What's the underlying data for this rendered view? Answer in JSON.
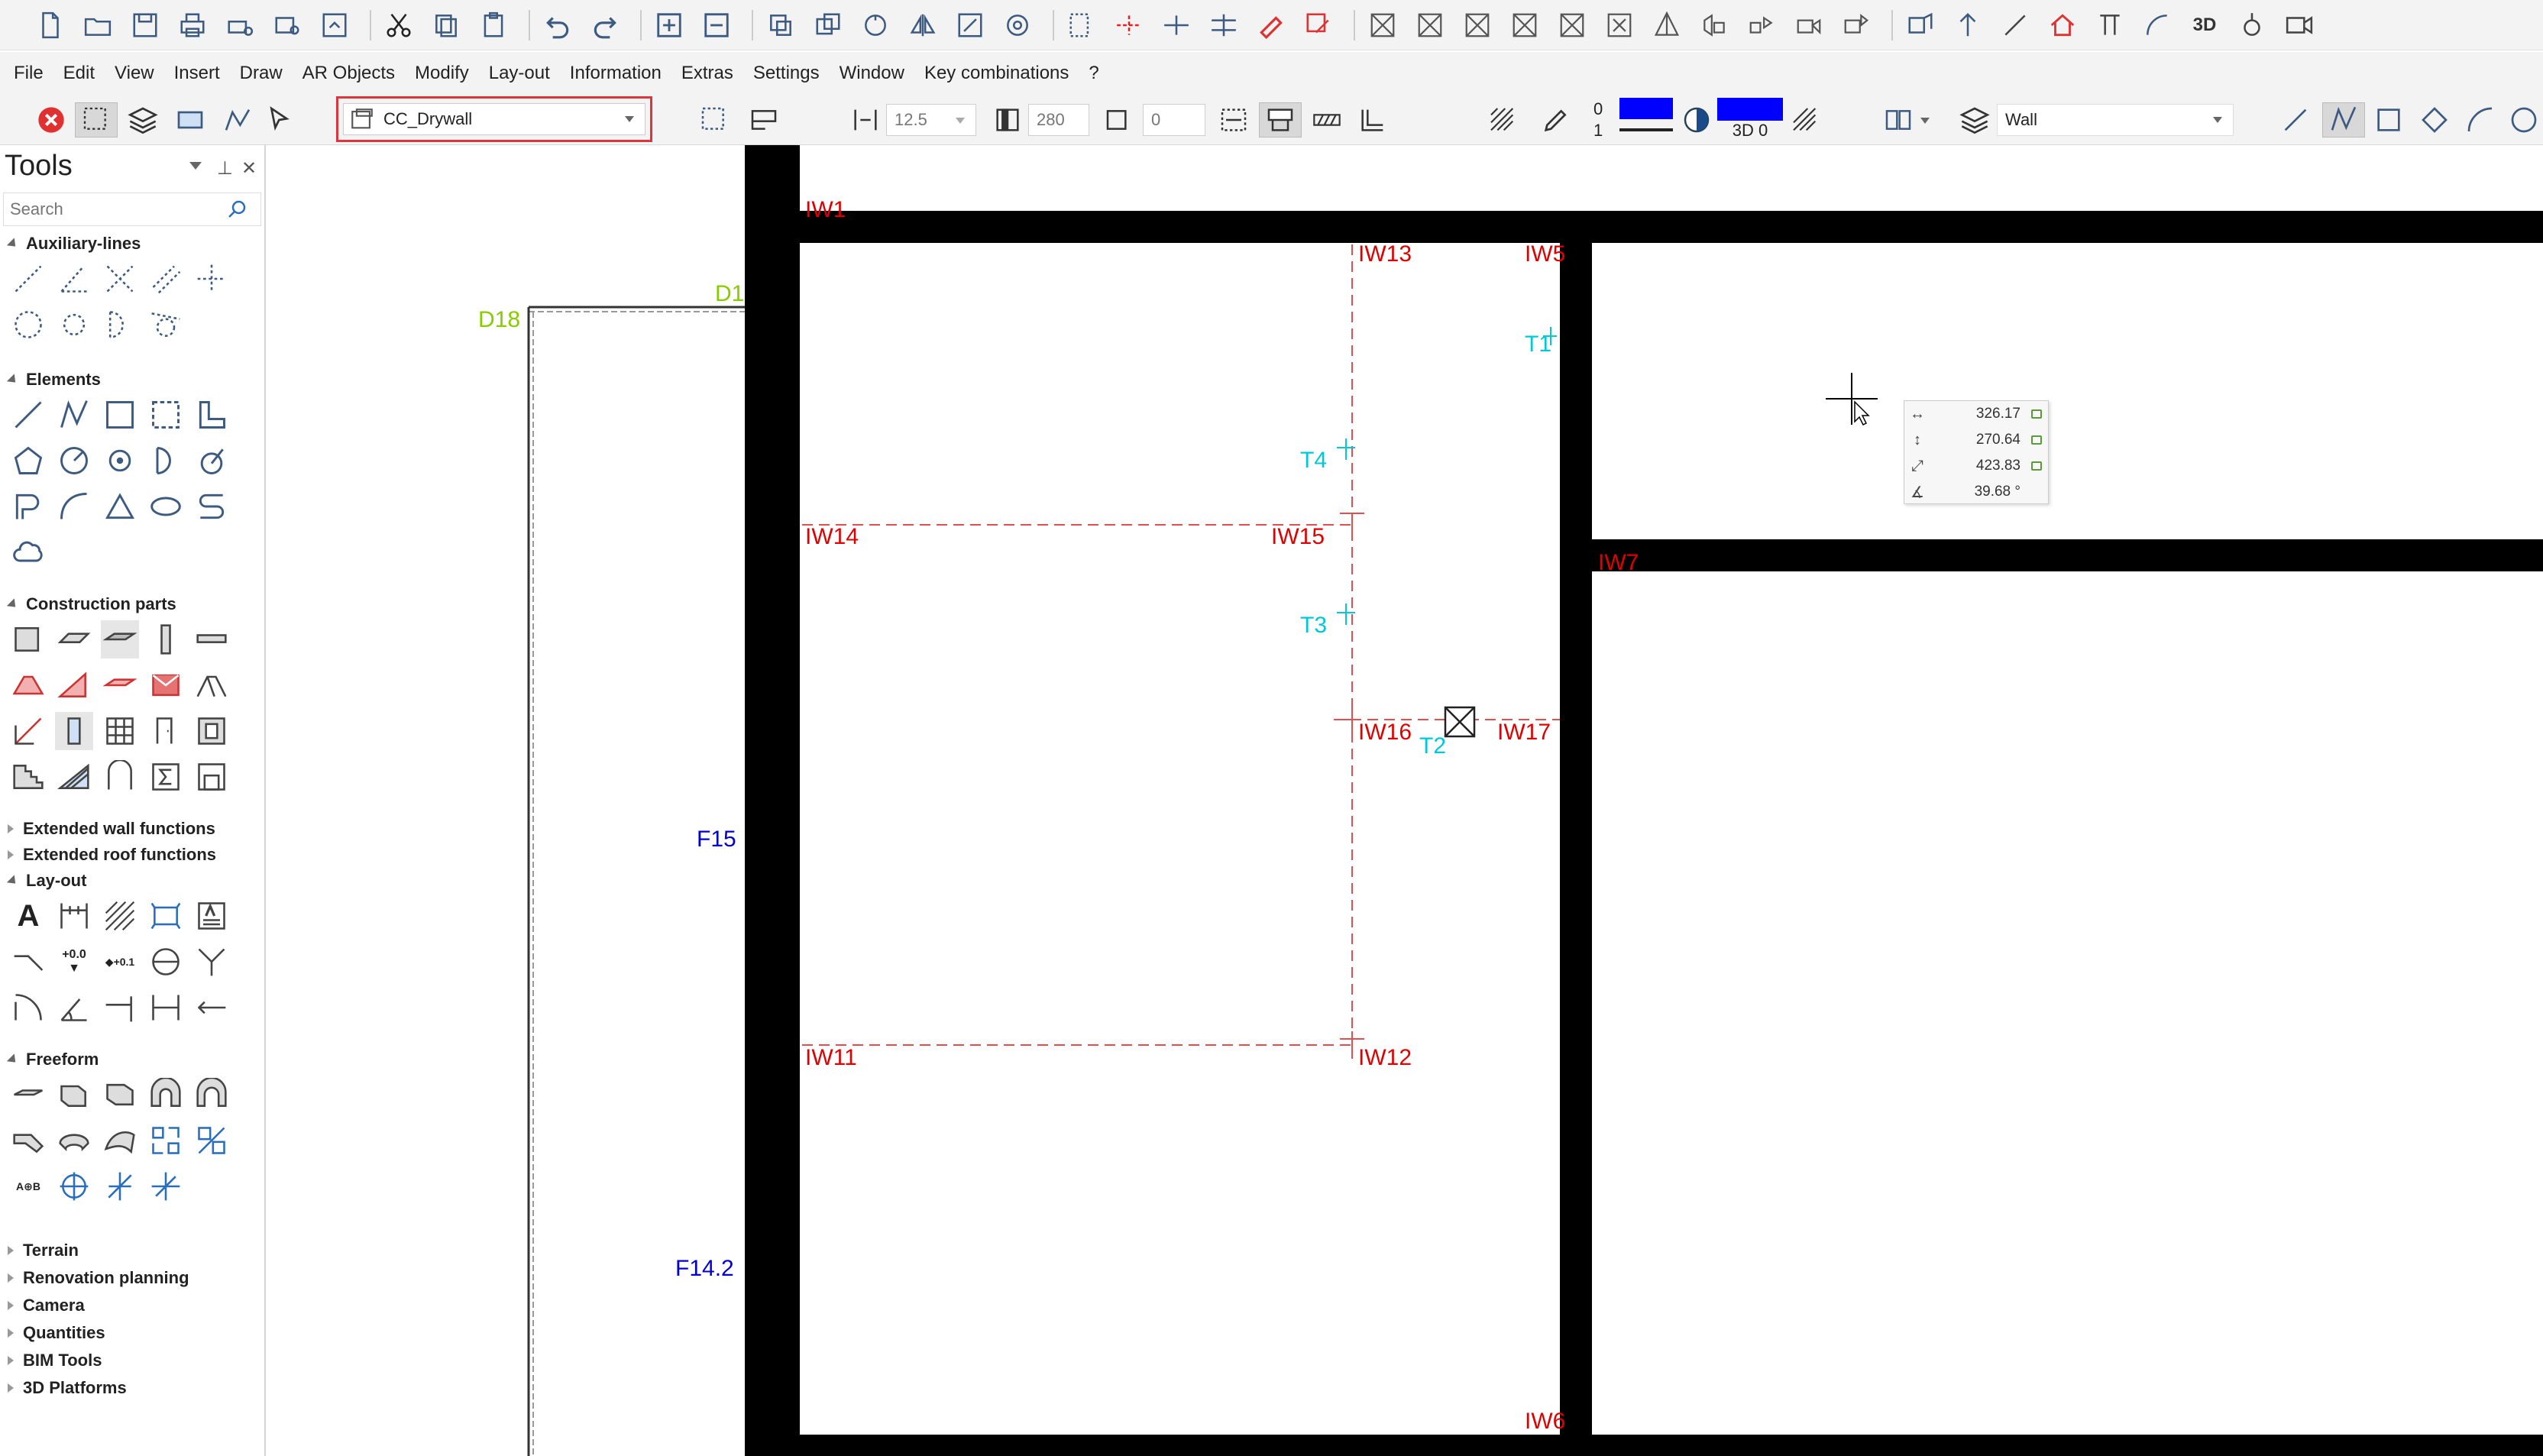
{
  "menu": [
    "File",
    "Edit",
    "View",
    "Insert",
    "Draw",
    "AR Objects",
    "Modify",
    "Lay-out",
    "Information",
    "Extras",
    "Settings",
    "Window",
    "Key combinations",
    "?"
  ],
  "props": {
    "style_select": "CC_Drywall",
    "thickness": "12.5",
    "height": "280",
    "offset": "0",
    "pen_top": "0",
    "pen_bottom": "1",
    "color_label": "3D 0",
    "layer_select": "Wall",
    "colors": {
      "pen": "#0000ff",
      "fill": "#0000ff"
    }
  },
  "tools": {
    "title": "Tools",
    "search_placeholder": "Search",
    "categories": {
      "auxiliary": "Auxiliary-lines",
      "elements": "Elements",
      "construction": "Construction parts",
      "ext_wall": "Extended wall functions",
      "ext_roof": "Extended roof functions",
      "layout": "Lay-out",
      "freeform": "Freeform",
      "terrain": "Terrain",
      "renovation": "Renovation planning",
      "camera": "Camera",
      "quantities": "Quantities",
      "bim": "BIM Tools",
      "platforms": "3D Platforms"
    },
    "layout_glyphs": {
      "text": "A",
      "height": "+0.0",
      "level": "+0.1"
    }
  },
  "canvas": {
    "labels": {
      "iw1": "IW1",
      "iw13": "IW13",
      "iw5": "IW5",
      "t1": "T1",
      "d18": "D18",
      "d1": "D1",
      "t4": "T4",
      "iw14": "IW14",
      "iw15": "IW15",
      "iw7": "IW7",
      "t3": "T3",
      "iw16": "IW16",
      "t2": "T2",
      "iw17": "IW17",
      "f15": "F15",
      "iw11": "IW11",
      "iw12": "IW12",
      "f142": "F14.2",
      "iw6": "IW6"
    }
  },
  "coordinate_tooltip": {
    "dx": "326.17",
    "dy": "270.64",
    "distance": "423.83",
    "angle": "39.68 °"
  }
}
